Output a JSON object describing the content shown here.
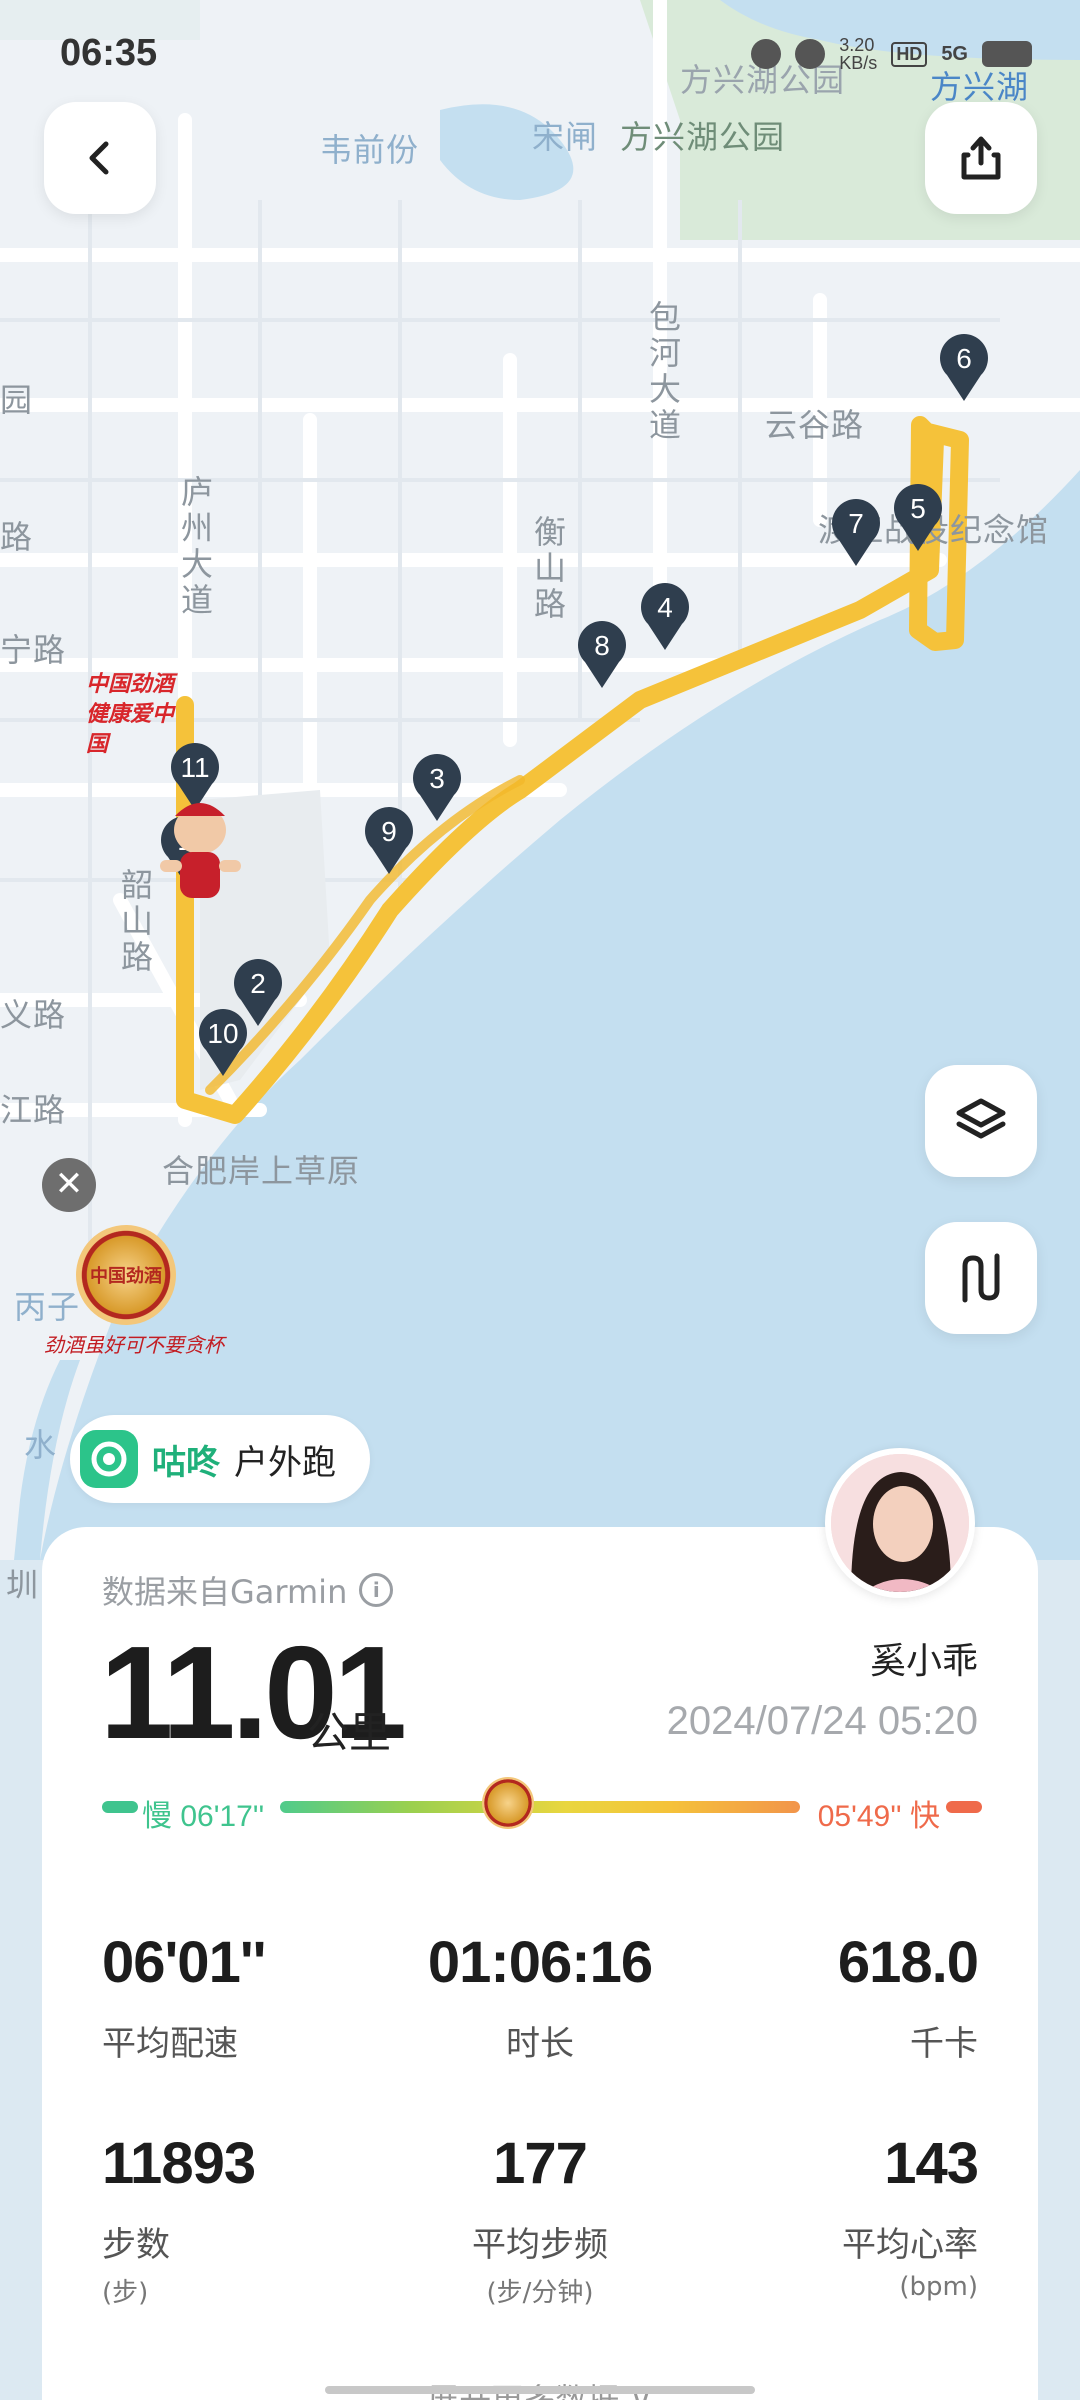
{
  "status_bar": {
    "time": "06:35",
    "overlay_text": "方",
    "network_speed": "3.20\nKB/s",
    "network_speed_top": "3.20",
    "network_speed_bottom": "KB/s",
    "hd": "HD",
    "signal": "5G"
  },
  "map": {
    "labels": {
      "fangxing_park_top": "方兴湖公园",
      "fangxing_lake": "方兴湖",
      "weiqianfen": "韦前份",
      "songzha": "宋闸",
      "fangxing_park": "方兴湖公园",
      "baohe_avenue": "包河大道",
      "yungu_road": "云谷路",
      "dujiang_memorial": "渡江战役纪念馆",
      "luzhou_avenue": "庐州大道",
      "hengshan_road": "衡山路",
      "shaoshan_road": "韶山路",
      "left_road_1": "园",
      "left_road_2": "路",
      "left_road_3": "宁路",
      "left_road_4": "义路",
      "left_road_5": "江路",
      "hefei_grassland": "合肥岸上草原",
      "left_bingzi": "丙子",
      "left_shui": "水",
      "left_zhen": "圳"
    },
    "ad_banner_top": "中国劲酒 健康爱中国",
    "ad_banner_bottom_logo": "中国劲酒",
    "ad_banner_bottom_slogan": "劲酒虽好可不要贪杯",
    "markers": [
      "1",
      "2",
      "3",
      "4",
      "5",
      "6",
      "7",
      "8",
      "9",
      "10",
      "11"
    ],
    "route_color": "#f5c23a",
    "water_color": "#c4dff0",
    "land_color": "#f0f3f6"
  },
  "buttons": {
    "back": "back",
    "share": "share",
    "layers": "layers",
    "elevation": "elevation"
  },
  "app_chip": {
    "app_name": "咕咚",
    "activity_type": "户外跑"
  },
  "summary": {
    "source_text": "数据来自Garmin",
    "distance_value": "11.01",
    "distance_unit": "公里",
    "user_name": "奚小乖",
    "datetime": "2024/07/24 05:20",
    "pace_slow_label": "慢 06'17''",
    "pace_fast_label": "05'49'' 快",
    "pace_slow_color": "#3fc48e",
    "pace_fast_color": "#ef6a4a"
  },
  "stats": [
    {
      "value": "06'01''",
      "label": "平均配速",
      "sub": ""
    },
    {
      "value": "01:06:16",
      "label": "时长",
      "sub": ""
    },
    {
      "value": "618.0",
      "label": "千卡",
      "sub": ""
    },
    {
      "value": "11893",
      "label": "步数",
      "sub": "(步)"
    },
    {
      "value": "177",
      "label": "平均步频",
      "sub": "(步/分钟)"
    },
    {
      "value": "143",
      "label": "平均心率",
      "sub": "(bpm)"
    }
  ],
  "expand_more": "展开更多数据 ∨"
}
